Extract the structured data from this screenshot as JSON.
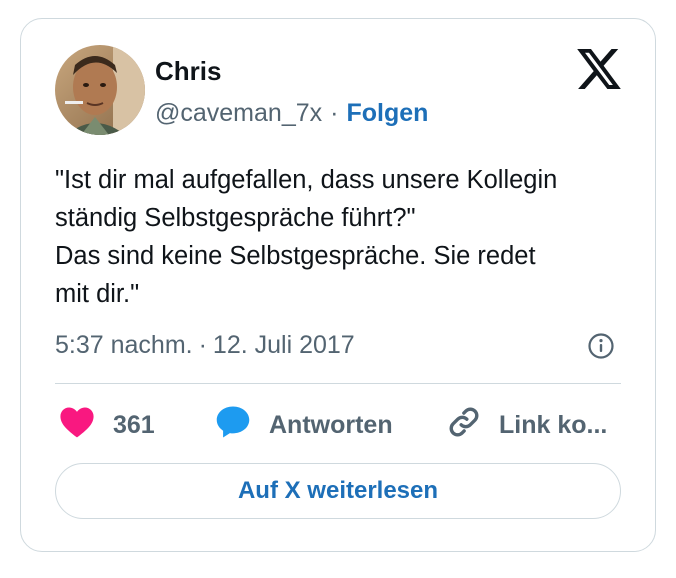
{
  "author": {
    "name": "Chris",
    "handle": "@caveman_7x",
    "separator": "·",
    "follow_label": "Folgen"
  },
  "icons": {
    "logo": "x-logo-icon",
    "info": "info-icon",
    "like": "heart-icon",
    "reply": "speech-bubble-icon",
    "link": "link-icon"
  },
  "tweet": {
    "text": "\"Ist dir mal aufgefallen, dass unsere Kollegin\nständig Selbstgespräche führt?\"\nDas sind keine Selbstgespräche. Sie redet\nmit dir.\"",
    "time": "5:37 nachm.",
    "separator": "·",
    "date": "12. Juli 2017"
  },
  "actions": {
    "like_count": "361",
    "reply_label": "Antworten",
    "link_label": "Link ko..."
  },
  "cta_label": "Auf X weiterlesen",
  "colors": {
    "heart": "#f91880",
    "reply_bubble": "#1d9bf0",
    "link_blue": "#1d6fb8",
    "muted_text": "#536471",
    "border": "#cfd9de"
  }
}
